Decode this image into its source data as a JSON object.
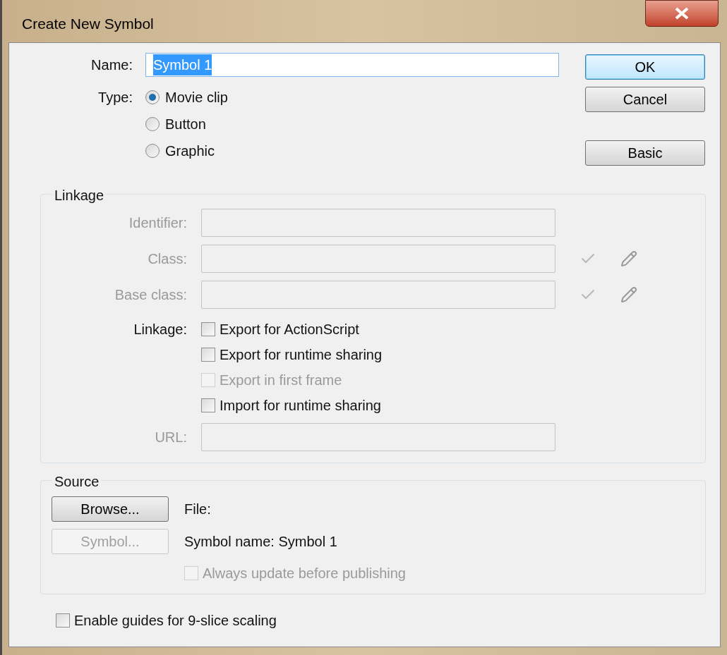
{
  "window": {
    "title": "Create New Symbol"
  },
  "name_field": {
    "label": "Name:",
    "value": "Symbol 1",
    "text_selected": true
  },
  "type": {
    "label": "Type:",
    "options": [
      {
        "label": "Movie clip",
        "selected": true
      },
      {
        "label": "Button",
        "selected": false
      },
      {
        "label": "Graphic",
        "selected": false
      }
    ]
  },
  "buttons": [
    {
      "label": "OK",
      "default": true
    },
    {
      "label": "Cancel",
      "default": false
    },
    {
      "label": "Basic",
      "default": false
    }
  ],
  "linkage": {
    "title": "Linkage",
    "fields": [
      {
        "label": "Identifier:",
        "kind": "plain",
        "disabled": true
      },
      {
        "label": "Class:",
        "kind": "with_actions",
        "disabled": true
      },
      {
        "label": "Base class:",
        "kind": "with_actions",
        "disabled": true
      }
    ],
    "options_label": "Linkage:",
    "options": [
      {
        "label": "Export for ActionScript",
        "checked": false,
        "disabled": false
      },
      {
        "label": "Export for runtime sharing",
        "checked": false,
        "disabled": false
      },
      {
        "label": "Export in first frame",
        "checked": false,
        "disabled": true
      },
      {
        "label": "Import for runtime sharing",
        "checked": false,
        "disabled": false
      }
    ],
    "url": {
      "label": "URL:",
      "disabled": true
    }
  },
  "source": {
    "title": "Source",
    "browse": {
      "label": "Browse...",
      "disabled": false
    },
    "file_label": "File:",
    "symbol_button": {
      "label": "Symbol...",
      "disabled": true
    },
    "symbol_name": "Symbol name: Symbol 1",
    "always_update": {
      "label": "Always update before publishing",
      "checked": false,
      "disabled": true
    }
  },
  "guides": {
    "label": "Enable guides for 9-slice scaling",
    "checked": false,
    "disabled": false
  }
}
